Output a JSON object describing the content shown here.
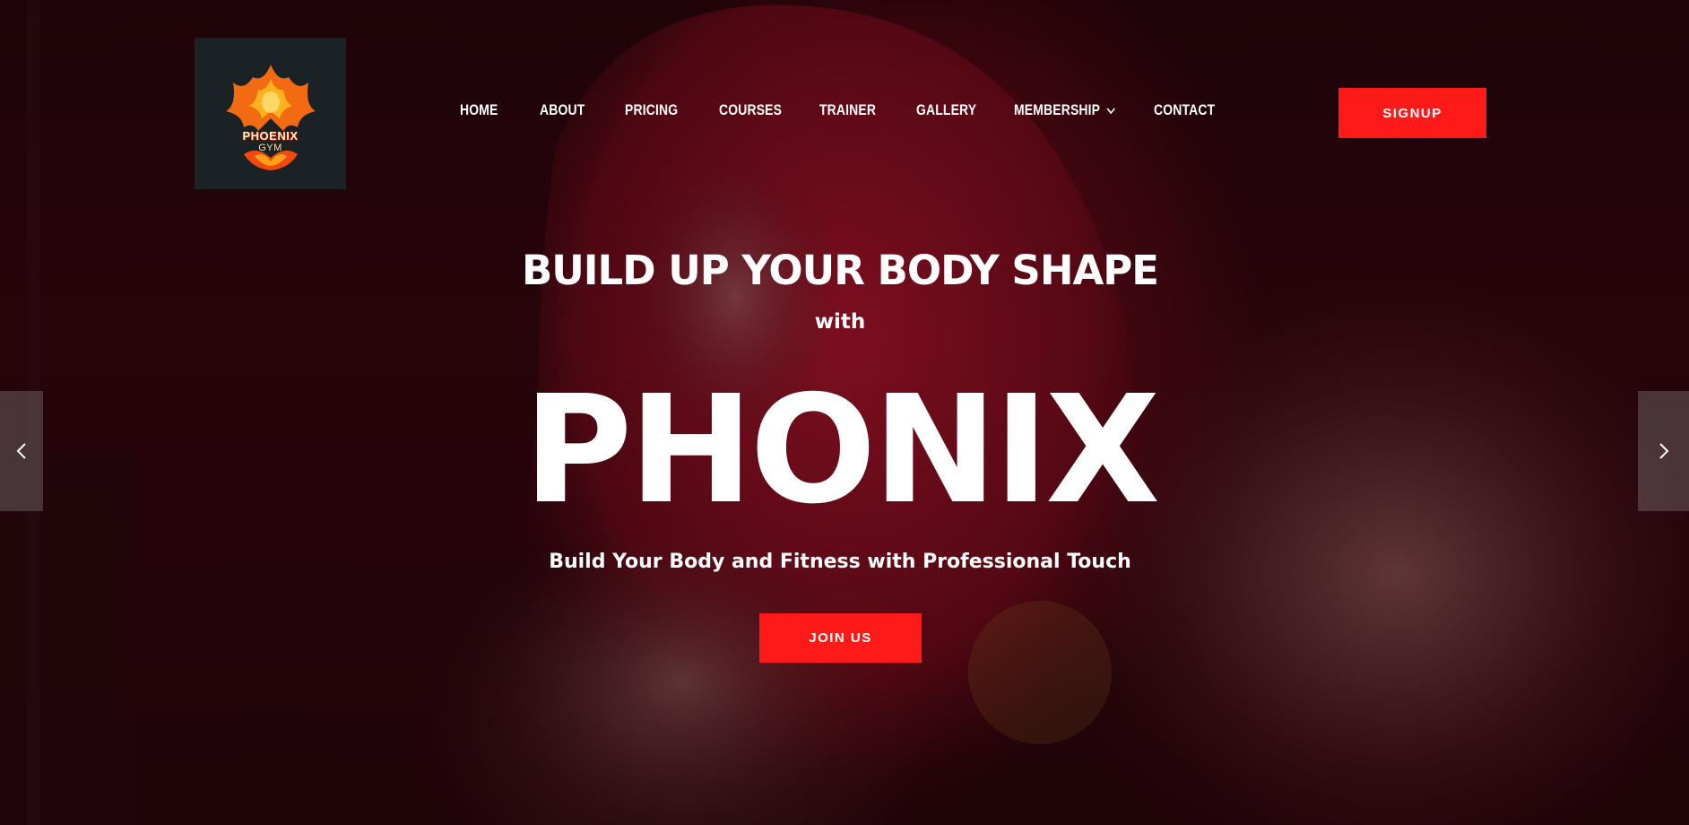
{
  "logo": {
    "line1": "PHOENIX",
    "line2": "GYM",
    "alt_icon": "phoenix-flame-icon"
  },
  "nav": {
    "items": [
      {
        "label": "HOME"
      },
      {
        "label": "ABOUT"
      },
      {
        "label": "PRICING"
      },
      {
        "label": "COURSES"
      },
      {
        "label": "TRAINER"
      },
      {
        "label": "GALLERY"
      },
      {
        "label": "MEMBERSHIP",
        "has_dropdown": true
      },
      {
        "label": "CONTACT"
      }
    ],
    "signup_label": "SIGNUP"
  },
  "hero": {
    "headline": "BUILD UP YOUR BODY SHAPE",
    "with_text": "with",
    "brand": "PHONIX",
    "subline": "Build Your Body and Fitness with Professional Touch",
    "cta_label": "JOIN US",
    "prev_icon": "chevron-left-icon",
    "next_icon": "chevron-right-icon"
  },
  "colors": {
    "accent": "#ff1a1a",
    "logo_bg": "#1b2226",
    "text": "#ffffff"
  }
}
